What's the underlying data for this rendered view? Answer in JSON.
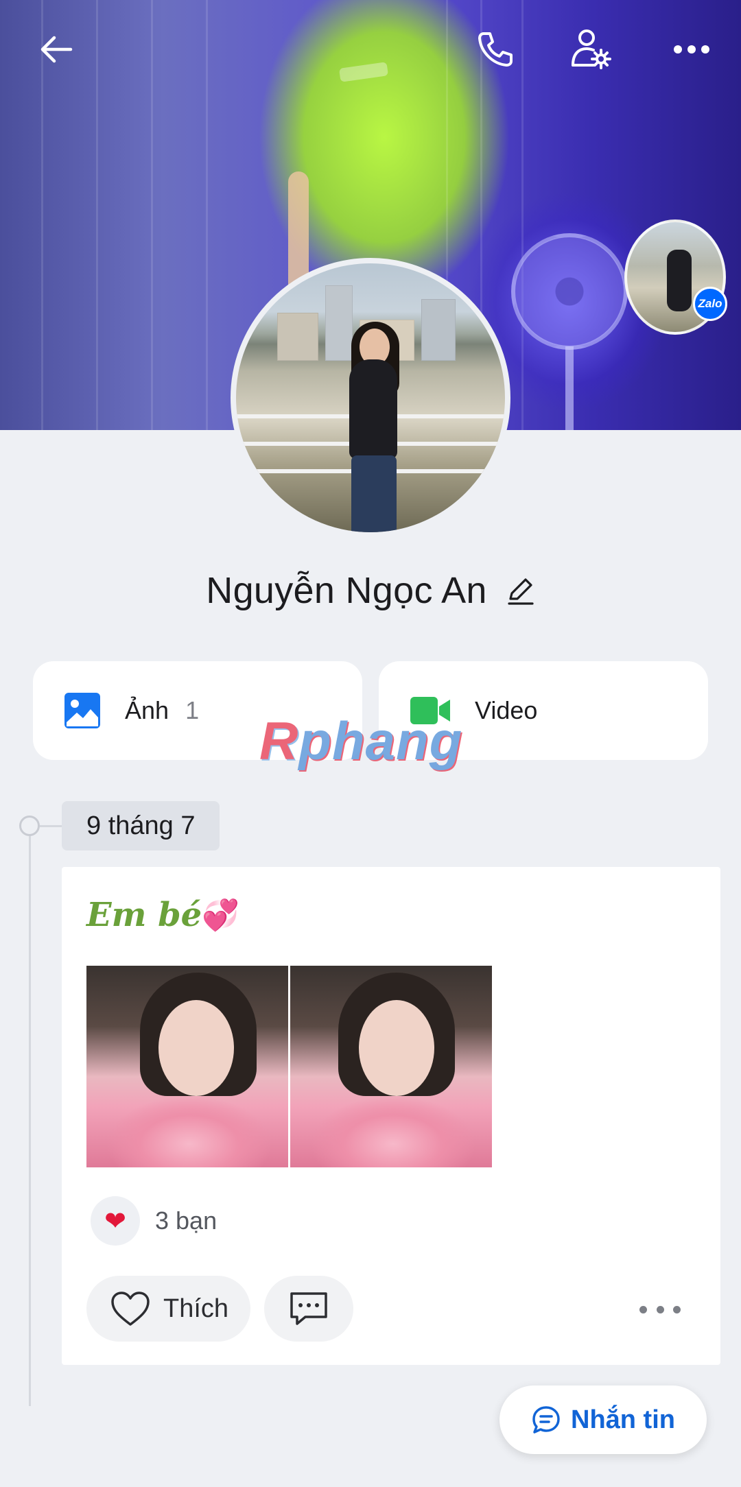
{
  "profile": {
    "name": "Nguyễn Ngọc An",
    "badge": "Zalo"
  },
  "media": {
    "photos_label": "Ảnh",
    "photos_count": "1",
    "video_label": "Video"
  },
  "watermark": {
    "first": "R",
    "rest": "phang"
  },
  "timeline": {
    "date": "9 tháng 7"
  },
  "post": {
    "text": "Em bé",
    "emoji": "💞",
    "reaction_icon": "❤",
    "reaction_text": "3 bạn",
    "like_label": "Thích"
  },
  "message_button": {
    "label": "Nhắn tin"
  },
  "icons": {
    "back": "back-arrow-icon",
    "call": "phone-icon",
    "settings": "user-settings-icon",
    "more": "more-icon",
    "edit": "pencil-icon",
    "photos": "image-icon",
    "video": "video-camera-icon",
    "like": "heart-outline-icon",
    "comment": "comment-icon",
    "message": "chat-bubble-icon"
  },
  "colors": {
    "accent_blue": "#1164d6",
    "photo_icon_blue": "#1877f2",
    "video_icon_green": "#2fbf5a",
    "heart_red": "#e2183a",
    "post_text_green": "#6aa13a"
  }
}
